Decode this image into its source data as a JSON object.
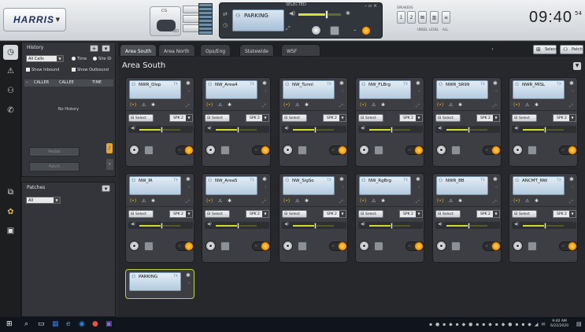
{
  "app": {
    "logo_text": "HARRIS",
    "clock": "09:40",
    "clock_seconds": "54",
    "phone_label": "CG",
    "phone_extra": "2D"
  },
  "selected_panel": {
    "title": "SELECTED",
    "channel": "PARKING"
  },
  "speakers": {
    "label": "SPEAKERS",
    "keys": [
      "1",
      "2"
    ],
    "unsel_label": "UNSEL",
    "level_label": "LEVEL",
    "all_label": "ALL"
  },
  "history": {
    "title": "History",
    "filter_value": "All Calls",
    "radio_time": "Time",
    "radio_site": "Site ID",
    "show_inbound": "Show Inbound",
    "show_outbound": "Show Outbound",
    "columns": [
      "CALLER",
      "CALLEE",
      "TIME"
    ],
    "empty_text": "No History",
    "btn_redial": "Redial",
    "btn_patch": "Patch"
  },
  "patches": {
    "title": "Patches",
    "filter_value": "All"
  },
  "tabs": [
    {
      "label": "Area South",
      "active": true
    },
    {
      "label": "Area North",
      "active": false
    },
    {
      "label": "Ops/Eng",
      "active": false
    },
    {
      "label": "Statewide",
      "active": false
    },
    {
      "label": "WSF",
      "active": false
    }
  ],
  "toolbar": {
    "select_label": "Select",
    "patch_label": "Patch"
  },
  "area_title": "Area South",
  "channels": [
    {
      "name": "NWR_Disp",
      "volume": 0.55
    },
    {
      "name": "NW_Area4",
      "volume": 0.55
    },
    {
      "name": "NW_Tunnl",
      "volume": 0.55
    },
    {
      "name": "NW_FLBrg",
      "volume": 0.55
    },
    {
      "name": "NWR_SR99",
      "volume": 0.55
    },
    {
      "name": "NWR_MISL",
      "volume": 0.55
    },
    {
      "name": "NW_IR",
      "volume": 0.55
    },
    {
      "name": "NW_Area5",
      "volume": 0.55
    },
    {
      "name": "NW_SigSo",
      "volume": 0.55
    },
    {
      "name": "NW_RgBrg",
      "volume": 0.55
    },
    {
      "name": "NWR_BB",
      "volume": 0.55
    },
    {
      "name": "ANCMT_NW",
      "volume": 0.55
    }
  ],
  "channel_ui": {
    "tx_label": "TX",
    "select_label": "Select",
    "speaker_value": "SPK 2"
  },
  "patch_card": {
    "name": "PARKING"
  },
  "taskbar": {
    "time": "9:40 AM",
    "date": "6/22/2020"
  }
}
